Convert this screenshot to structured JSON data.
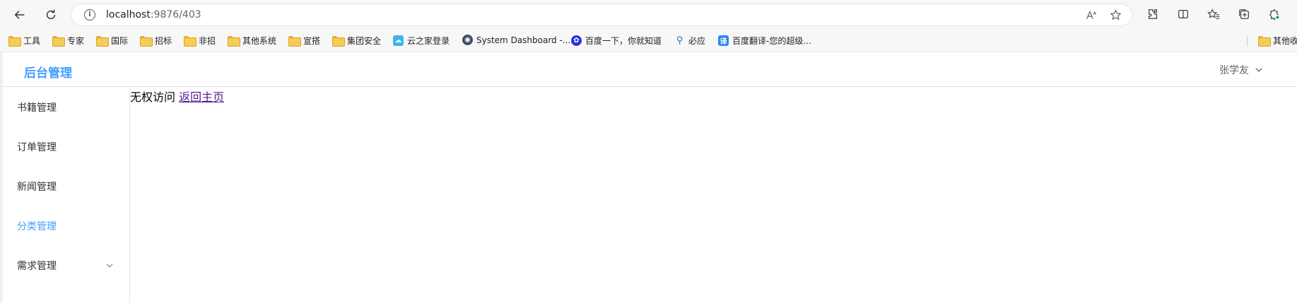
{
  "browser": {
    "url_host": "localhost",
    "url_rest": ":9876/403",
    "icons": [
      "back-icon",
      "reload-icon",
      "info-icon",
      "read-aloud-icon",
      "favorite-star-icon",
      "extensions-icon",
      "split-screen-icon",
      "favorites-icon",
      "collections-icon",
      "profile-icon"
    ]
  },
  "bookmarks": [
    {
      "label": "工具",
      "icon": "folder"
    },
    {
      "label": "专家",
      "icon": "folder"
    },
    {
      "label": "国际",
      "icon": "folder"
    },
    {
      "label": "招标",
      "icon": "folder"
    },
    {
      "label": "非招",
      "icon": "folder"
    },
    {
      "label": "其他系统",
      "icon": "folder"
    },
    {
      "label": "宣搭",
      "icon": "folder"
    },
    {
      "label": "集团安全",
      "icon": "folder"
    },
    {
      "label": "云之家登录",
      "icon": "cloud"
    },
    {
      "label": "System Dashboard -...",
      "icon": "dashboard"
    },
    {
      "label": "百度一下，你就知道",
      "icon": "baidu"
    },
    {
      "label": "必应",
      "icon": "search"
    },
    {
      "label": "百度翻译-您的超级...",
      "icon": "translate"
    },
    {
      "label": "其他收",
      "icon": "folder"
    }
  ],
  "app": {
    "title": "后台管理",
    "user": "张学友",
    "menu": [
      {
        "label": "书籍管理",
        "active": false
      },
      {
        "label": "订单管理",
        "active": false
      },
      {
        "label": "新闻管理",
        "active": false
      },
      {
        "label": "分类管理",
        "active": true
      },
      {
        "label": "需求管理",
        "active": false,
        "expandable": true
      }
    ],
    "message": "无权访问",
    "home_link": "返回主页"
  },
  "colors": {
    "accent": "#409eff",
    "link_visited": "#551a8b"
  }
}
